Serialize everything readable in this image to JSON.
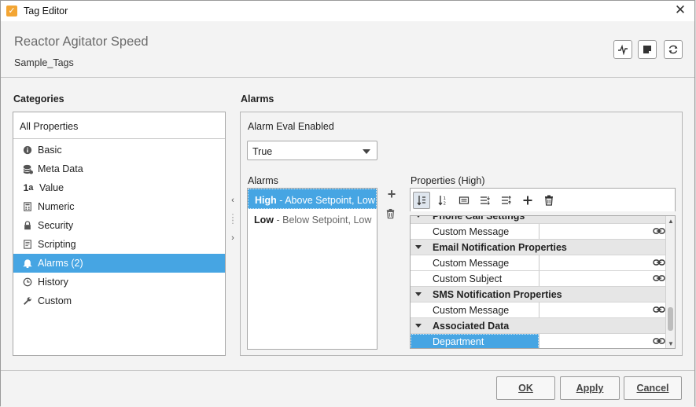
{
  "window": {
    "title": "Tag Editor",
    "close_glyph": "✕"
  },
  "header": {
    "tag_name": "Reactor Agitator Speed",
    "tag_provider": "Sample_Tags"
  },
  "categories": {
    "label": "Categories",
    "all": "All Properties",
    "items": [
      {
        "label": "Basic",
        "icon": "info-icon"
      },
      {
        "label": "Meta Data",
        "icon": "database-icon"
      },
      {
        "label": "Value",
        "icon": "value-icon"
      },
      {
        "label": "Numeric",
        "icon": "calculator-icon"
      },
      {
        "label": "Security",
        "icon": "lock-icon"
      },
      {
        "label": "Scripting",
        "icon": "script-icon"
      },
      {
        "label": "Alarms (2)",
        "icon": "bell-icon",
        "selected": true
      },
      {
        "label": "History",
        "icon": "clock-icon"
      },
      {
        "label": "Custom",
        "icon": "wrench-icon"
      }
    ]
  },
  "alarms_section": {
    "label": "Alarms",
    "eval_label": "Alarm Eval Enabled",
    "eval_value": "True",
    "list_label": "Alarms",
    "list": [
      {
        "name": "High",
        "desc": " - Above Setpoint, Low",
        "selected": true
      },
      {
        "name": "Low",
        "desc": " - Below Setpoint, Low",
        "selected": false
      }
    ],
    "add_glyph": "+"
  },
  "properties": {
    "label": "Properties (High)",
    "rows": [
      {
        "name": "Phone Call Settings",
        "group": true,
        "partial": true
      },
      {
        "name": "Custom Message",
        "group": false
      },
      {
        "name": "Email Notification Properties",
        "group": true
      },
      {
        "name": "Custom Message",
        "group": false
      },
      {
        "name": "Custom Subject",
        "group": false
      },
      {
        "name": "SMS Notification Properties",
        "group": true
      },
      {
        "name": "Custom Message",
        "group": false
      },
      {
        "name": "Associated Data",
        "group": true
      },
      {
        "name": "Department",
        "group": false,
        "selected": true
      }
    ]
  },
  "footer": {
    "ok": "OK",
    "apply": "Apply",
    "cancel": "Cancel"
  },
  "colors": {
    "accent": "#46a5e3",
    "app_icon": "#f3a533"
  }
}
